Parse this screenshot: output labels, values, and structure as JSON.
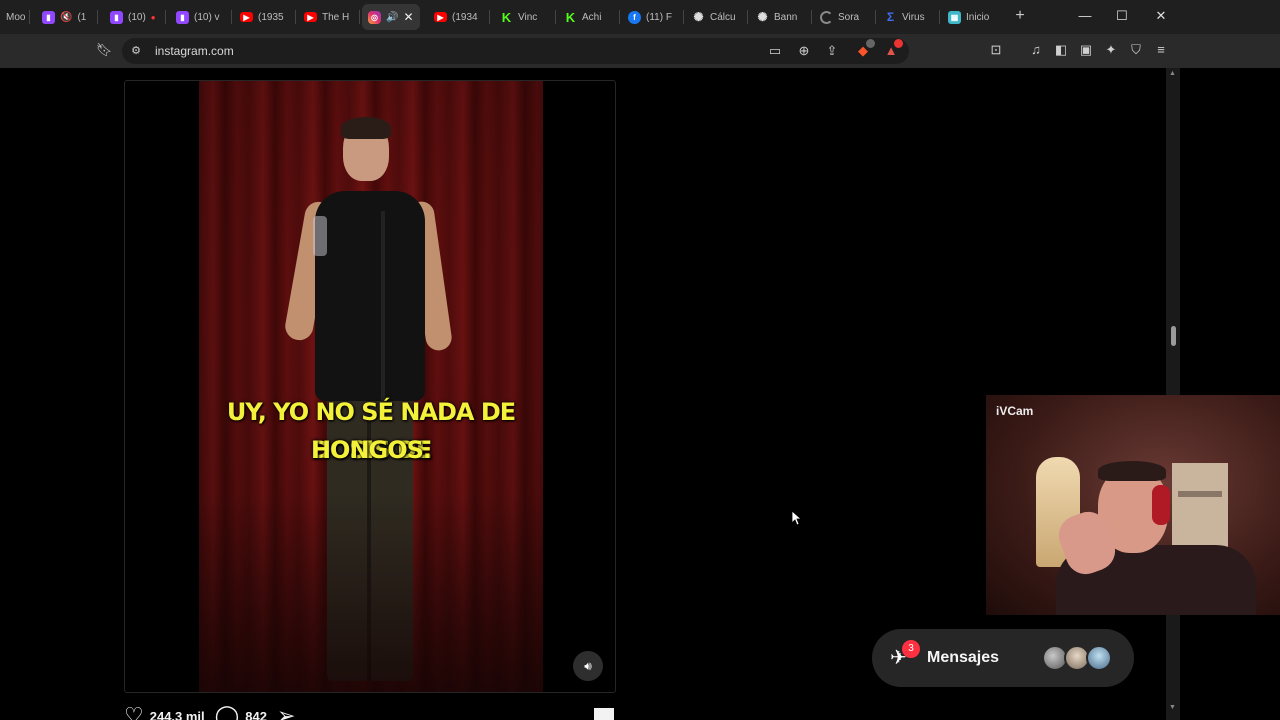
{
  "browser": {
    "tabs": [
      {
        "label": "Moo",
        "favicon": "moon-icon"
      },
      {
        "label": "(1",
        "favicon": "twitch-icon"
      },
      {
        "label": "(10)",
        "favicon": "twitch-icon"
      },
      {
        "label": "(10) v",
        "favicon": "twitch-icon"
      },
      {
        "label": "(1935",
        "favicon": "youtube-icon"
      },
      {
        "label": "The H",
        "favicon": "youtube-icon"
      },
      {
        "label": "",
        "favicon": "instagram-icon"
      },
      {
        "label": "(1934",
        "favicon": "youtube-icon"
      },
      {
        "label": "Vinc",
        "favicon": "kick-icon"
      },
      {
        "label": "Achi",
        "favicon": "kick-icon"
      },
      {
        "label": "(11) F",
        "favicon": "facebook-icon"
      },
      {
        "label": "Cálcu",
        "favicon": "openai-icon"
      },
      {
        "label": "Bann",
        "favicon": "openai-icon"
      },
      {
        "label": "Sora",
        "favicon": "loading-icon"
      },
      {
        "label": "Virus",
        "favicon": "virustotal-icon"
      },
      {
        "label": "Inicio",
        "favicon": "app-icon"
      }
    ],
    "url": "instagram.com"
  },
  "post": {
    "caption_line1": "UY, YO NO SÉ NADA DE DOSIS DE",
    "caption_line2": "HONGOS.",
    "likes": "244,3 mil",
    "comments": "842"
  },
  "webcam": {
    "label": "iVCam"
  },
  "messages": {
    "label": "Mensajes",
    "badge": "3"
  },
  "colors": {
    "caption": "#f4f13a",
    "badge": "#ff3040",
    "background": "#000000"
  }
}
